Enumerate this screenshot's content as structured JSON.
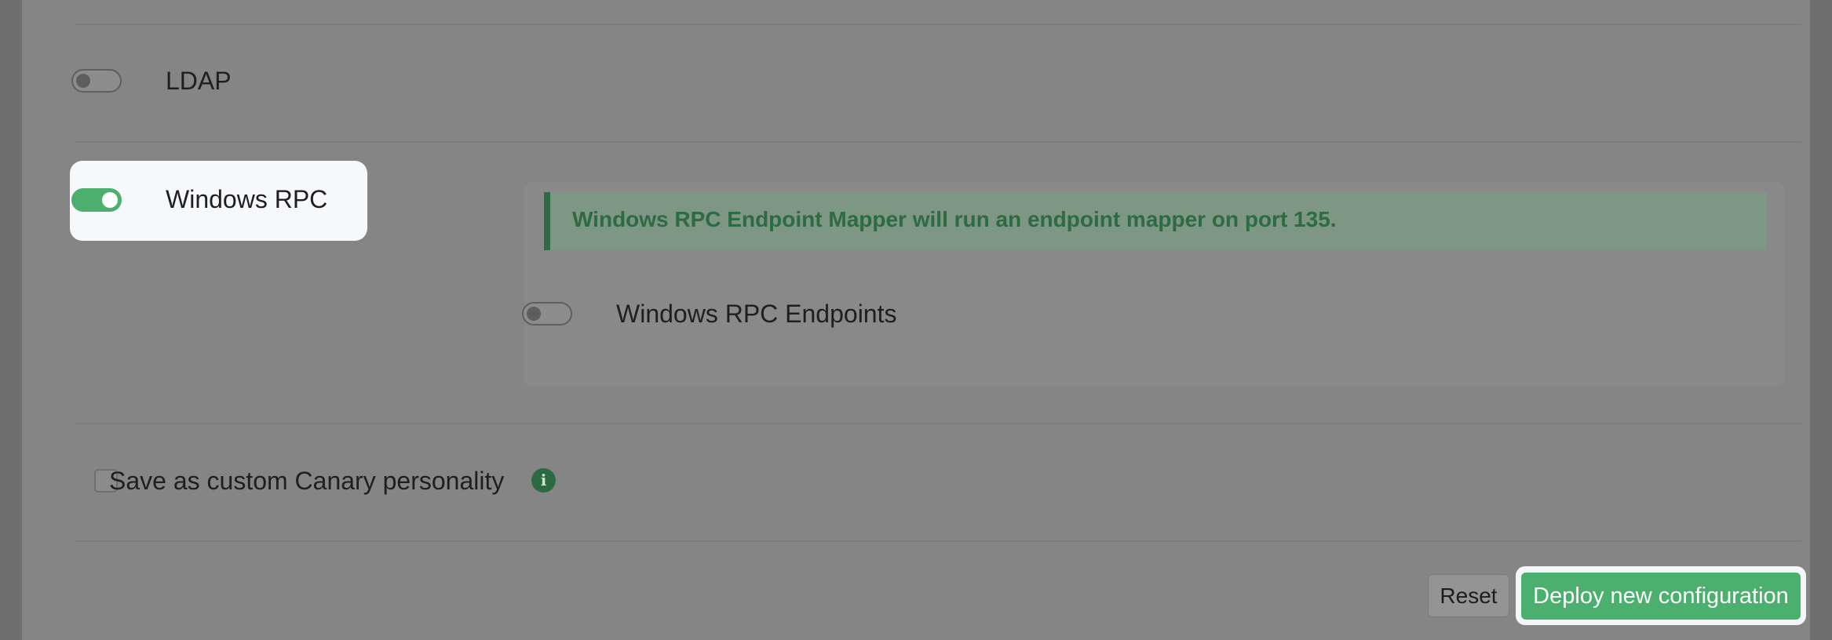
{
  "services": {
    "ldap": {
      "label": "LDAP",
      "enabled": false
    },
    "windows_rpc": {
      "label": "Windows RPC",
      "enabled": true,
      "info_message": "Windows RPC Endpoint Mapper will run an endpoint mapper on port 135.",
      "endpoints": {
        "label": "Windows RPC Endpoints",
        "enabled": false
      }
    }
  },
  "personality": {
    "label": "Save as custom Canary personality",
    "checked": false,
    "info_icon": "i"
  },
  "actions": {
    "reset_label": "Reset",
    "deploy_label": "Deploy new configuration"
  },
  "colors": {
    "accent_green": "#4caf6e",
    "alert_text": "#2d6b42"
  }
}
